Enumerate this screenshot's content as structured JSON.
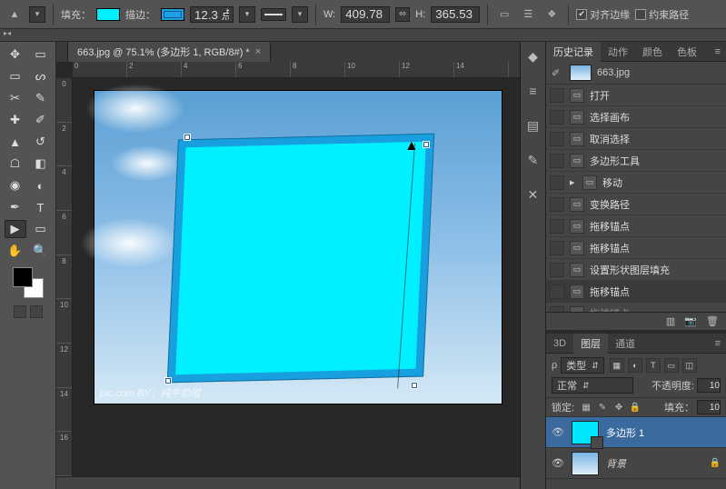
{
  "options": {
    "tool_glyph": "▲",
    "fill_label": "填充：",
    "stroke_label": "描边：",
    "stroke_width": "12.3 点",
    "w_label": "W:",
    "w_value": "409.78",
    "h_label": "H:",
    "h_value": "365.53",
    "align_edges_label": "对齐边缘",
    "constrain_label": "约束路径"
  },
  "doc_tab": {
    "title": "663.jpg @ 75.1% (多边形 1, RGB/8#) *"
  },
  "ruler_h": [
    "0",
    "2",
    "4",
    "6",
    "8",
    "10",
    "12",
    "14"
  ],
  "ruler_v": [
    "0",
    "2",
    "4",
    "6",
    "8",
    "10",
    "12",
    "14",
    "16"
  ],
  "watermark": "pic.com   BY：纯牛奶啦",
  "panels": {
    "history": {
      "tabs": [
        "历史记录",
        "动作",
        "颜色",
        "色板"
      ],
      "doc_name": "663.jpg",
      "items": [
        {
          "label": "打开"
        },
        {
          "label": "选择画布"
        },
        {
          "label": "取消选择"
        },
        {
          "label": "多边形工具"
        },
        {
          "label": "移动",
          "arrow": true
        },
        {
          "label": "变换路径"
        },
        {
          "label": "拖移锚点"
        },
        {
          "label": "拖移锚点"
        },
        {
          "label": "设置形状图层填充"
        },
        {
          "label": "拖移锚点"
        },
        {
          "label": "拖移锚点",
          "dim": true
        }
      ]
    },
    "layers": {
      "tabs": [
        "3D",
        "图层",
        "通道"
      ],
      "kind_label": "类型",
      "blend_mode": "正常",
      "opacity_label": "不透明度:",
      "opacity_value": "10",
      "lock_label": "锁定:",
      "fill_label": "填充：",
      "fill_value": "10",
      "items": [
        {
          "name": "多边形 1",
          "type": "shape"
        },
        {
          "name": "背景",
          "type": "image",
          "locked": true,
          "italic": true
        }
      ]
    }
  }
}
